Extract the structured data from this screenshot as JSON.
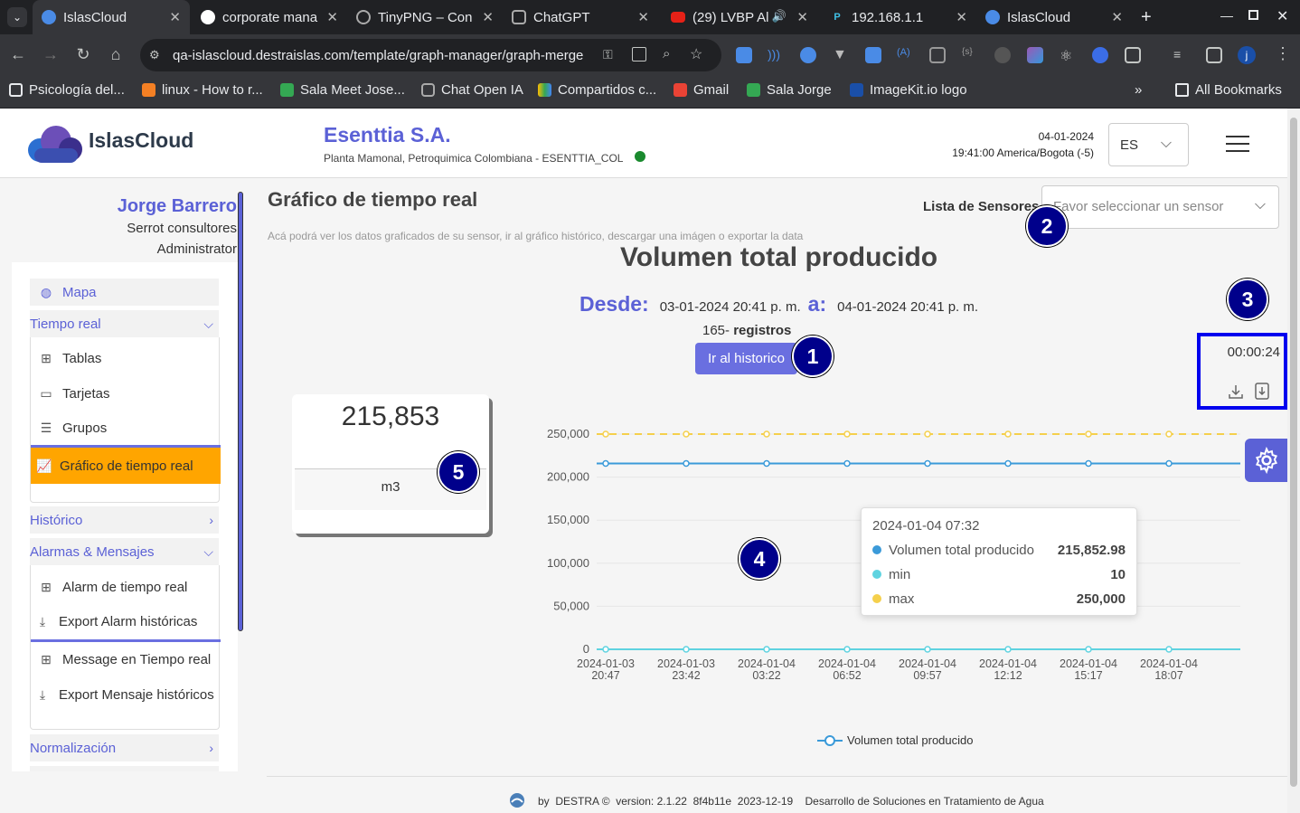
{
  "browser": {
    "tabs": [
      {
        "title": "IslasCloud",
        "active": true
      },
      {
        "title": "corporate mana",
        "active": false
      },
      {
        "title": "TinyPNG – Con",
        "active": false
      },
      {
        "title": "ChatGPT",
        "active": false
      },
      {
        "title": "(29) LVBP Al",
        "active": false
      },
      {
        "title": "192.168.1.1",
        "active": false
      },
      {
        "title": "IslasCloud",
        "active": false
      }
    ],
    "url": "qa-islascloud.destraislas.com/template/graph-manager/graph-merge",
    "profile_initial": "j",
    "bookmarks": [
      "Psicología del...",
      "linux - How to r...",
      "Sala Meet Jose...",
      "Chat Open IA",
      "Compartidos c...",
      "Gmail",
      "Sala Jorge",
      "ImageKit.io logo"
    ],
    "all_bookmarks": "All Bookmarks"
  },
  "header": {
    "brand": "IslasCloud",
    "company": "Esenttia S.A.",
    "plant": "Planta Mamonal, Petroquimica Colombiana - ESENTTIA_COL",
    "date": "04-01-2024",
    "time": "19:41:00 America/Bogota (-5)",
    "language": "ES",
    "status_color": "#1a8a2e"
  },
  "user": {
    "name": "Jorge Barrero",
    "company": "Serrot consultores",
    "role": "Administrator"
  },
  "menu": {
    "mapa": "Mapa",
    "tiempo_real": "Tiempo real",
    "tablas": "Tablas",
    "tarjetas": "Tarjetas",
    "grupos": "Grupos",
    "grafico": "Gráfico de tiempo real",
    "historico": "Histórico",
    "alarmas": "Alarmas & Mensajes",
    "alarm_tr": "Alarm de tiempo real",
    "export_alarm": "Export Alarm históricas",
    "message_tr": "Message en Tiempo real",
    "export_msg": "Export Mensaje históricos",
    "normalizacion": "Normalización"
  },
  "page": {
    "title": "Gráfico de tiempo real",
    "subtitle": "Acá podrá ver los datos graficados de su sensor, ir al gráfico histórico, descargar una imágen o exportar la data",
    "sensor_label": "Lista de Sensores",
    "sensor_placeholder": "Favor seleccionar un sensor",
    "chart_title": "Volumen total producido",
    "desde_label": "Desde:",
    "desde_value": "03-01-2024 20:41 p. m.",
    "a_label": "a:",
    "a_value": "04-01-2024 20:41 p. m.",
    "records_count": "165-",
    "records_label": "registros",
    "hist_button": "Ir al historico",
    "timer": "00:00:24"
  },
  "markers": {
    "m1": "1",
    "m2": "2",
    "m3": "3",
    "m4": "4",
    "m5": "5"
  },
  "card": {
    "value": "215,853",
    "unit": "m3"
  },
  "tooltip": {
    "date": "2024-01-04 07:32",
    "rows": [
      {
        "name": "Volumen total producido",
        "value": "215,852.98",
        "color": "#3b9ad9"
      },
      {
        "name": "min",
        "value": "10",
        "color": "#5fd3e0"
      },
      {
        "name": "max",
        "value": "250,000",
        "color": "#f5d04c"
      }
    ]
  },
  "chart_data": {
    "type": "line",
    "title": "Volumen total producido",
    "x": [
      "2024-01-03 20:47",
      "2024-01-03 23:42",
      "2024-01-04 03:22",
      "2024-01-04 06:52",
      "2024-01-04 09:57",
      "2024-01-04 12:12",
      "2024-01-04 15:17",
      "2024-01-04 18:07"
    ],
    "yticks": [
      0,
      50000,
      100000,
      150000,
      200000,
      250000
    ],
    "ylim": [
      0,
      250000
    ],
    "series": [
      {
        "name": "Volumen total producido",
        "values": [
          215852.98,
          215852.98,
          215852.98,
          215852.98,
          215852.98,
          215852.98,
          215852.98,
          215852.98
        ],
        "color": "#3b9ad9"
      },
      {
        "name": "min",
        "values": [
          10,
          10,
          10,
          10,
          10,
          10,
          10,
          10
        ],
        "color": "#5fd3e0"
      },
      {
        "name": "max",
        "values": [
          250000,
          250000,
          250000,
          250000,
          250000,
          250000,
          250000,
          250000
        ],
        "color": "#f5d04c"
      }
    ],
    "legend": "bottom",
    "legend_entries": [
      "Volumen total producido"
    ],
    "grid": true
  },
  "footer": {
    "by": "by",
    "company": "DESTRA ©",
    "version": "version: 2.1.22",
    "commit": "8f4b11e",
    "date": "2023-12-19",
    "desc": "Desarrollo de Soluciones en Tratamiento de Agua"
  }
}
